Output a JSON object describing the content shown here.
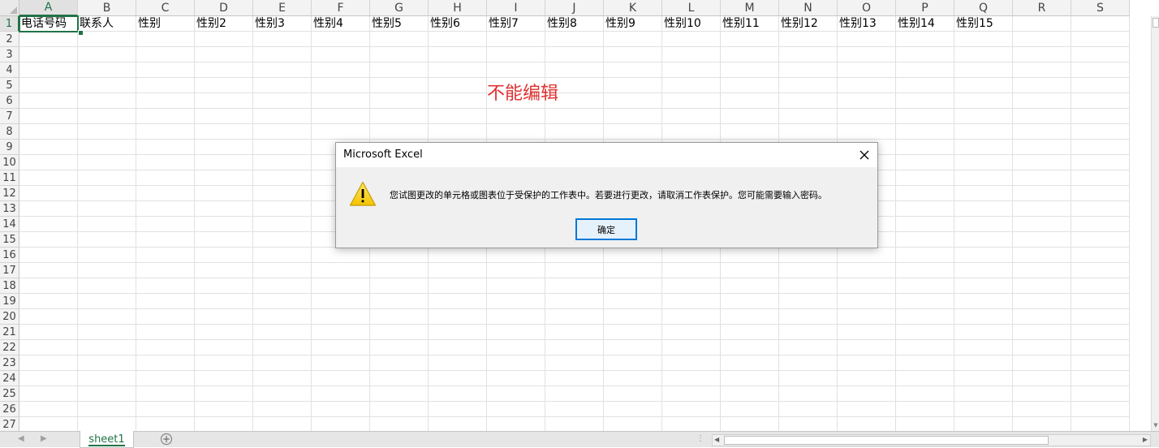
{
  "columns": [
    "A",
    "B",
    "C",
    "D",
    "E",
    "F",
    "G",
    "H",
    "I",
    "J",
    "K",
    "L",
    "M",
    "N",
    "O",
    "P",
    "Q",
    "R",
    "S"
  ],
  "rows": [
    "1",
    "2",
    "3",
    "4",
    "5",
    "6",
    "7",
    "8",
    "9",
    "10",
    "11",
    "12",
    "13",
    "14",
    "15",
    "16",
    "17",
    "18",
    "19",
    "20",
    "21",
    "22",
    "23",
    "24",
    "25",
    "26",
    "27"
  ],
  "row1_values": [
    "电话号码",
    "联系人",
    "性别",
    "性别2",
    "性别3",
    "性别4",
    "性别5",
    "性别6",
    "性别7",
    "性别8",
    "性别9",
    "性别10",
    "性别11",
    "性别12",
    "性别13",
    "性别14",
    "性别15",
    "",
    ""
  ],
  "selected_cell": "A1",
  "annotation": {
    "text": "不能编辑",
    "color": "#e03131"
  },
  "sheet_tab": {
    "label": "sheet1"
  },
  "add_sheet": {
    "symbol": "+"
  },
  "dialog": {
    "title": "Microsoft Excel",
    "message": "您试图更改的单元格或图表位于受保护的工作表中。若要进行更改，请取消工作表保护。您可能需要输入密码。",
    "ok_label": "确定",
    "icon": "warning-icon"
  },
  "colors": {
    "accent": "#217346",
    "button_border": "#0078d7",
    "warning": "#ffcc00"
  }
}
